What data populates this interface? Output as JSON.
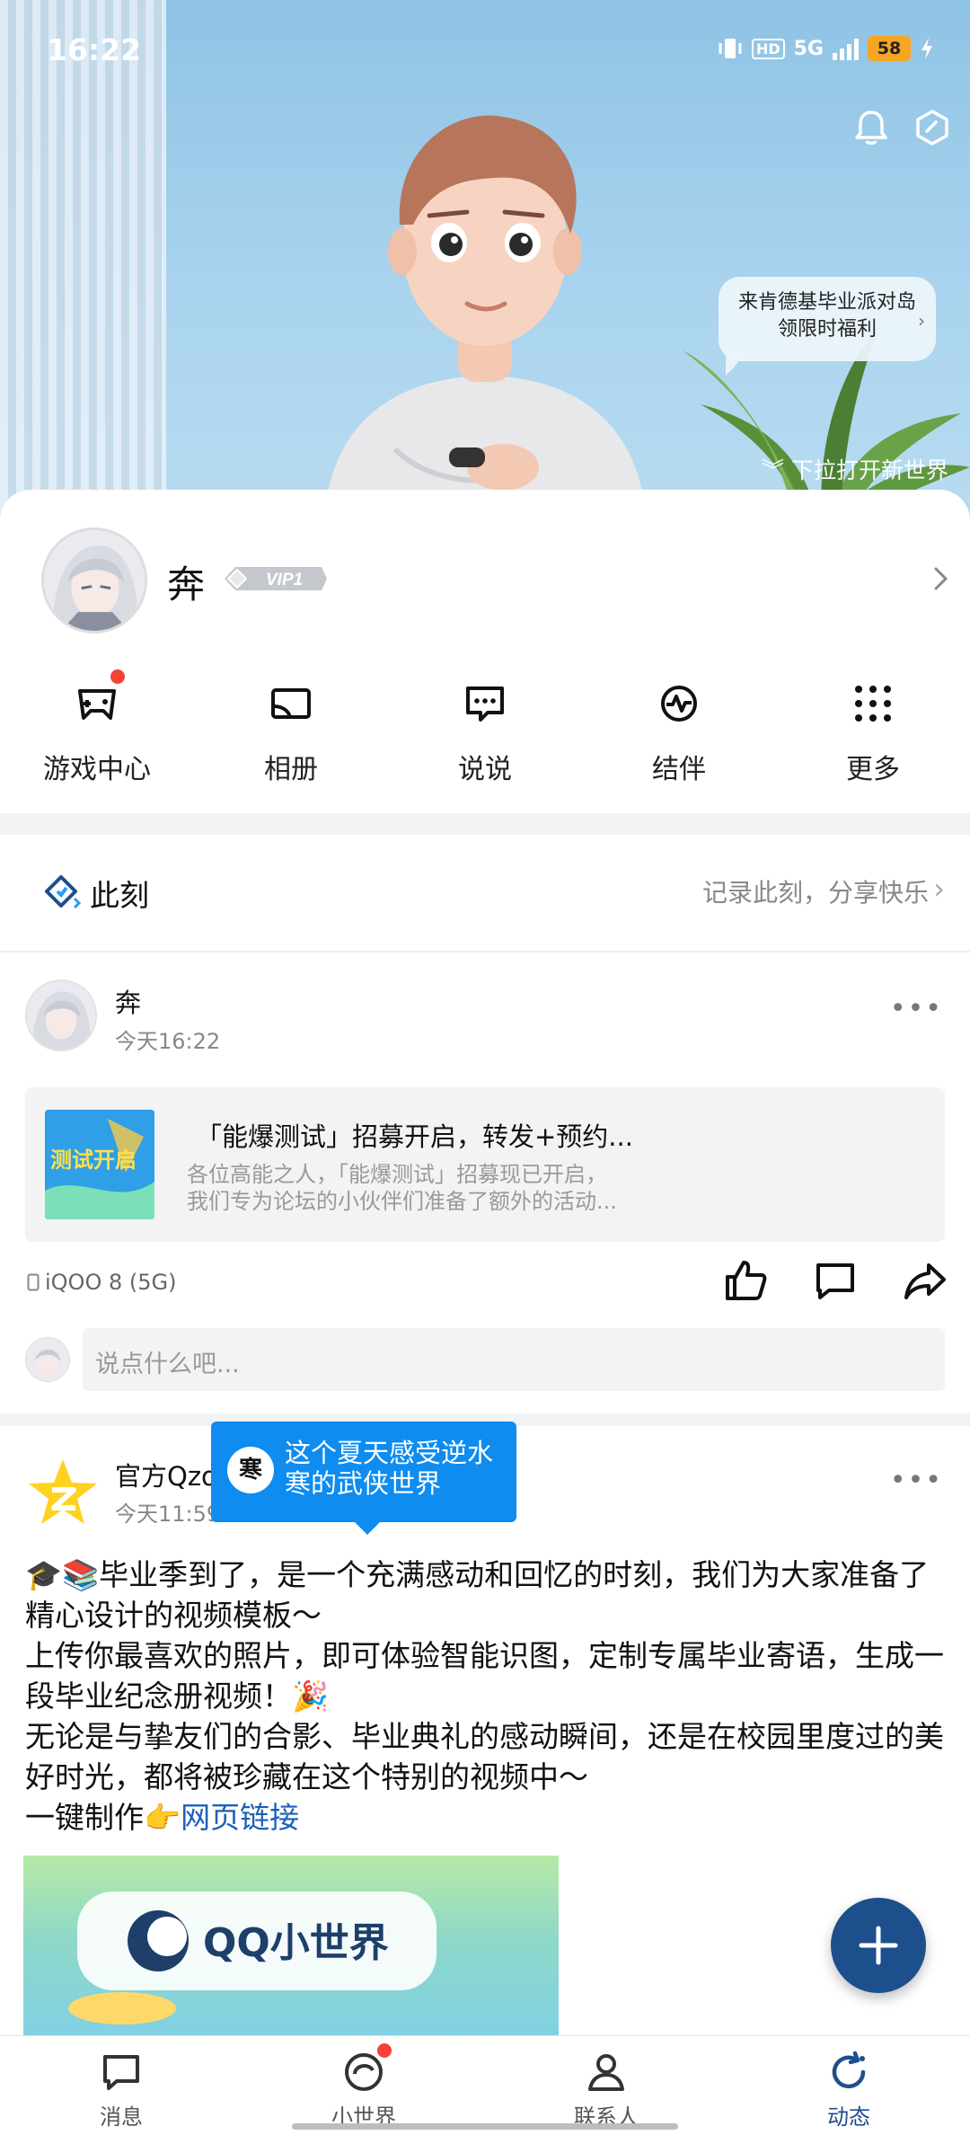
{
  "status": {
    "time": "16:22",
    "network": "5G",
    "hd": "HD",
    "battery": "58"
  },
  "hero": {
    "bubble_line1": "来肯德基毕业派对岛",
    "bubble_line2": "领限时福利",
    "pulldown": "下拉打开新世界"
  },
  "profile": {
    "name": "奔",
    "vip": "VIP1"
  },
  "shortcuts": [
    {
      "label": "游戏中心",
      "icon": "gamepad-icon"
    },
    {
      "label": "相册",
      "icon": "album-icon"
    },
    {
      "label": "说说",
      "icon": "chat-bubble-icon"
    },
    {
      "label": "结伴",
      "icon": "companion-icon"
    },
    {
      "label": "更多",
      "icon": "grid-more-icon"
    }
  ],
  "moment": {
    "title": "此刻",
    "hint": "记录此刻，分享快乐"
  },
  "post1": {
    "author": "奔",
    "time": "今天16:22",
    "share_title": "「能爆测试」招募开启，转发+预约...",
    "share_desc_line1": "各位高能之人，「能爆测试」招募现已开启，",
    "share_desc_line2": "我们专为论坛的小伙伴们准备了额外的活动...",
    "thumb_text": "测试开启",
    "device": "iQOO 8 (5G)",
    "comment_placeholder": "说点什么吧..."
  },
  "post2": {
    "author": "官方Qzone",
    "time": "今天11:59",
    "body_line1": "🎓📚毕业季到了，是一个充满感动和回忆的时刻，我们为大家准备了精心设计的视频模板～",
    "body_line2": "上传你最喜欢的照片，即可体验智能识图，定制专属毕业寄语，生成一段毕业纪念册视频！🎉",
    "body_line3": "无论是与挚友们的合影、毕业典礼的感动瞬间，还是在校园里度过的美好时光，都将被珍藏在这个特别的视频中～",
    "body_line4_prefix": "一键制作👉",
    "body_link": "网页链接",
    "media_text": "QQ小世界"
  },
  "banner": {
    "line1": "这个夏天感受逆水",
    "line2": "寒的武侠世界",
    "icon_char": "寒"
  },
  "nav": [
    {
      "label": "消息",
      "icon": "message-icon"
    },
    {
      "label": "小世界",
      "icon": "small-world-icon"
    },
    {
      "label": "联系人",
      "icon": "contacts-icon"
    },
    {
      "label": "动态",
      "icon": "refresh-feed-icon"
    }
  ],
  "colors": {
    "accent": "#1d4f8c",
    "badge": "#f44336",
    "link": "#1d5fb8",
    "banner": "#0e8cf0"
  }
}
